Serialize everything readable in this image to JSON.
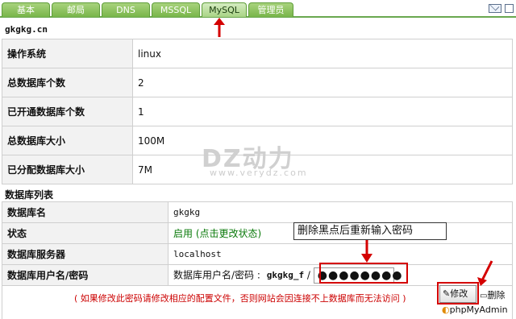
{
  "tabs": [
    {
      "label": "基本"
    },
    {
      "label": "邮局"
    },
    {
      "label": "DNS"
    },
    {
      "label": "MSSQL"
    },
    {
      "label": "MySQL",
      "active": true
    },
    {
      "label": "管理员"
    }
  ],
  "domain": "gkgkg.cn",
  "info_rows": [
    {
      "label": "操作系统",
      "value": "linux"
    },
    {
      "label": "总数据库个数",
      "value": "2"
    },
    {
      "label": "已开通数据库个数",
      "value": "1"
    },
    {
      "label": "总数据库大小",
      "value": "100M"
    },
    {
      "label": "已分配数据库大小",
      "value": "7M"
    }
  ],
  "db_list": {
    "title": "数据库列表",
    "name_label": "数据库名",
    "name_value": "gkgkg",
    "status_label": "状态",
    "status_value": "启用 (点击更改状态)",
    "server_label": "数据库服务器",
    "server_value": "localhost",
    "cred_label": "数据库用户名/密码",
    "cred_prefix": "数据库用户名/密码 :",
    "username": "gkgkg_f",
    "separator": "/",
    "password_mask": "●●●●●●●●"
  },
  "warning": "( 如果修改此密码请修改相应的配置文件，否则网站会因连接不上数据库而无法访问 )",
  "buttons": {
    "edit": "修改",
    "delete": "删除",
    "phpmyadmin": "phpMyAdmin"
  },
  "callout": "删除黑点后重新输入密码",
  "watermark": {
    "logo": "DZ动力",
    "url": "www.verydz.com"
  },
  "colors": {
    "tab_green": "#78b54a",
    "warning_red": "#cc0000",
    "annotation_red": "#d40000",
    "status_green": "#0a7a0a"
  }
}
